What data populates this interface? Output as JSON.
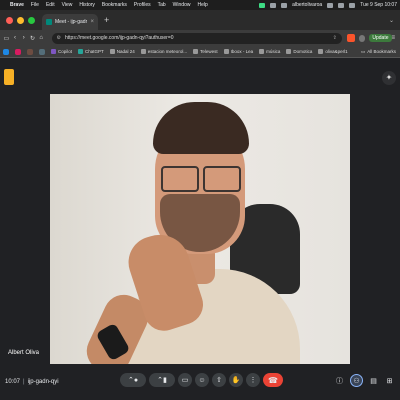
{
  "menubar": {
    "app": "Brave",
    "items": [
      "File",
      "Edit",
      "View",
      "History",
      "Bookmarks",
      "Profiles",
      "Tab",
      "Window",
      "Help"
    ],
    "user": "albertolivaroa",
    "datetime": "Tue 9 Sep 10:07"
  },
  "tab": {
    "title": "Meet - ijp-gadn-qyi"
  },
  "address": {
    "url": "https://meet.google.com/ijp-gadn-qyi?authuser=0"
  },
  "toolbar": {
    "update_label": "Update"
  },
  "bookmarks": {
    "items": [
      "Copilot",
      "ChatGPT",
      "Nadal 24",
      "estacion meteorol...",
      "Telewest",
      "Iboox - Lea",
      "música",
      "Domotica",
      "oliva&perl1"
    ],
    "all_label": "All Bookmarks"
  },
  "meet": {
    "participant_name": "Albert Oliva",
    "time": "10:07",
    "meeting_code": "ijp-gadn-qyi"
  },
  "colors": {
    "end_call": "#ea4335",
    "meet_logo": "#f6b026",
    "brave": "#fb542b"
  }
}
